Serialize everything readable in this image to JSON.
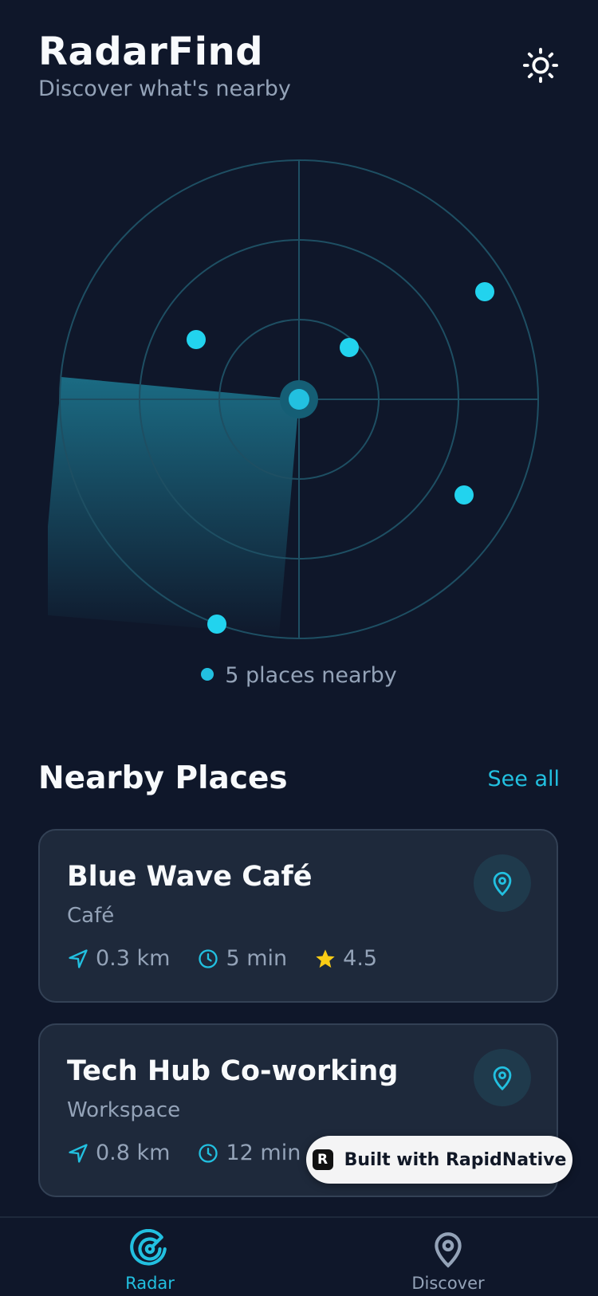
{
  "header": {
    "title": "RadarFind",
    "subtitle": "Discover what's nearby",
    "theme_icon": "sun-icon"
  },
  "radar": {
    "caption": "5 places nearby",
    "accent_color": "#22c0e0",
    "places_count": 5
  },
  "section": {
    "title": "Nearby Places",
    "see_all": "See all"
  },
  "places": [
    {
      "name": "Blue Wave Café",
      "category": "Café",
      "distance": "0.3 km",
      "time": "5 min",
      "rating": "4.5"
    },
    {
      "name": "Tech Hub Co-working",
      "category": "Workspace",
      "distance": "0.8 km",
      "time": "12 min"
    }
  ],
  "badge": {
    "logo": "R",
    "text": "Built with RapidNative"
  },
  "tabs": [
    {
      "label": "Radar",
      "icon": "radar-icon",
      "active": true
    },
    {
      "label": "Discover",
      "icon": "map-pin-icon",
      "active": false
    }
  ],
  "colors": {
    "background": "#0f172a",
    "card": "#1e293b",
    "accent": "#22c0e0",
    "star": "#facc15",
    "muted": "#94a3b8"
  }
}
